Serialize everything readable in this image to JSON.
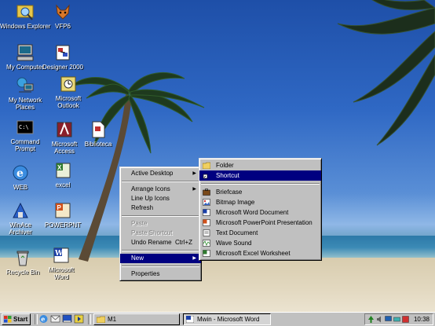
{
  "desktop_icons": [
    {
      "label": "Windows Explorer",
      "icon": "explorer-icon"
    },
    {
      "label": "VFP6",
      "icon": "foxpro-icon"
    },
    {
      "label": "My Computer",
      "icon": "computer-icon"
    },
    {
      "label": "Designer 2000",
      "icon": "designer-icon"
    },
    {
      "label": "My Network Places",
      "icon": "network-icon"
    },
    {
      "label": "Microsoft Outlook",
      "icon": "outlook-icon"
    },
    {
      "label": "Command Prompt",
      "icon": "console-icon"
    },
    {
      "label": "Microsoft Access",
      "icon": "access-icon"
    },
    {
      "label": "Biblioteca",
      "icon": "document-icon"
    },
    {
      "label": "WEB",
      "icon": "internet-explorer-icon"
    },
    {
      "label": "excel",
      "icon": "excel-icon"
    },
    {
      "label": "WinAce Archiver",
      "icon": "archiver-icon"
    },
    {
      "label": "POWERPNT",
      "icon": "powerpoint-icon"
    },
    {
      "label": "Recycle Bin",
      "icon": "recycle-bin-icon"
    },
    {
      "label": "Microsoft Word",
      "icon": "word-icon"
    }
  ],
  "context_menu": {
    "active_desktop": "Active Desktop",
    "arrange_icons": "Arrange Icons",
    "line_up_icons": "Line Up Icons",
    "refresh": "Refresh",
    "paste": "Paste",
    "paste_shortcut": "Paste Shortcut",
    "undo_rename": "Undo Rename",
    "undo_shortcut": "Ctrl+Z",
    "new": "New",
    "properties": "Properties"
  },
  "new_submenu": {
    "folder": "Folder",
    "shortcut": "Shortcut",
    "briefcase": "Briefcase",
    "bitmap": "Bitmap Image",
    "word_doc": "Microsoft Word Document",
    "ppt": "Microsoft PowerPoint Presentation",
    "text": "Text Document",
    "wave": "Wave Sound",
    "excel": "Microsoft Excel Worksheet"
  },
  "taskbar": {
    "start": "Start",
    "task1": "M1",
    "task2": "Mwin - Microsoft Word",
    "clock": "10:38"
  }
}
